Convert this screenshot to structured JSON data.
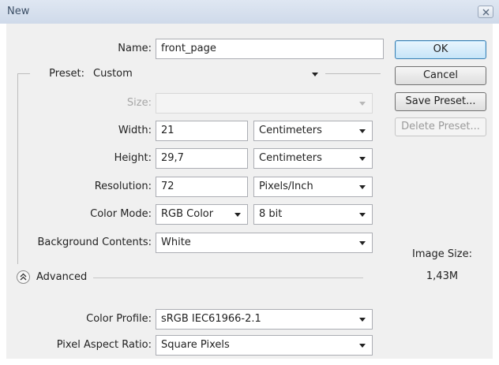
{
  "window": {
    "title": "New",
    "close_icon": "close-x-icon"
  },
  "form": {
    "name": {
      "label": "Name:",
      "value": "front_page"
    },
    "preset": {
      "label": "Preset:",
      "value": "Custom"
    },
    "size": {
      "label": "Size:",
      "value": ""
    },
    "width": {
      "label": "Width:",
      "value": "21",
      "unit": "Centimeters"
    },
    "height": {
      "label": "Height:",
      "value": "29,7",
      "unit": "Centimeters"
    },
    "resolution": {
      "label": "Resolution:",
      "value": "72",
      "unit": "Pixels/Inch"
    },
    "color_mode": {
      "label": "Color Mode:",
      "value": "RGB Color",
      "depth": "8 bit"
    },
    "background": {
      "label": "Background Contents:",
      "value": "White"
    },
    "advanced": {
      "label": "Advanced",
      "icon": "collapse-chevron-icon"
    },
    "color_profile": {
      "label": "Color Profile:",
      "value": "sRGB IEC61966-2.1"
    },
    "pixel_aspect": {
      "label": "Pixel Aspect Ratio:",
      "value": "Square Pixels"
    }
  },
  "buttons": {
    "ok": "OK",
    "cancel": "Cancel",
    "save_preset": "Save Preset...",
    "delete_preset": "Delete Preset..."
  },
  "image_size": {
    "label": "Image Size:",
    "value": "1,43M"
  }
}
